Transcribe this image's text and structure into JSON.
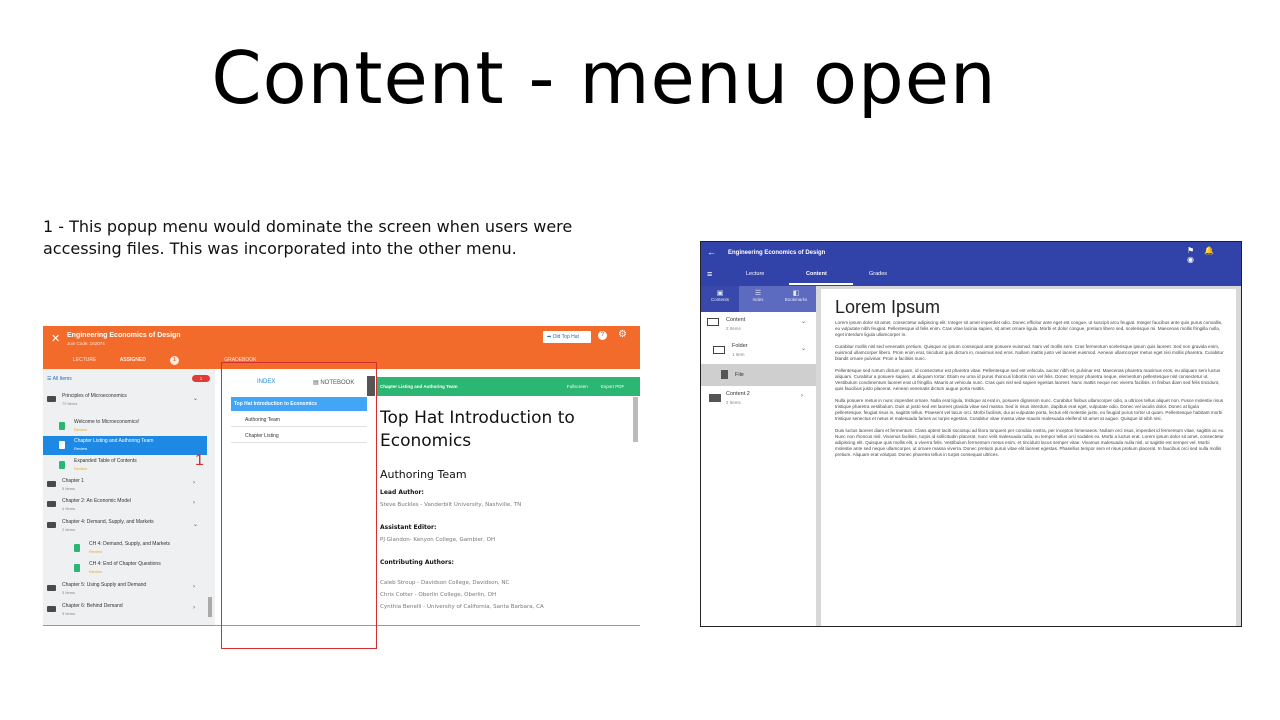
{
  "slide": {
    "title": "Content - menu open",
    "caption": "1 - This popup menu would dominate the screen when users were accessing files. This was incorporated into the other menu."
  },
  "left": {
    "course_title": "Engineering Economics of Design",
    "join_code": "Join Code: 162074",
    "tabs": [
      "LECTURE",
      "ASSIGNED",
      "GRADEBOOK"
    ],
    "assigned_badge": "1",
    "old_top_hat": "Old Top Hat",
    "filter_label": "All Items",
    "filter_badge": "1",
    "marker": "1",
    "sidebar": [
      {
        "title": "Principles of Microeconomics",
        "sub": "79 Items",
        "kind": "folder",
        "chev": "⌄"
      },
      {
        "title": "Welcome to Microeconomics!",
        "sub": "Review",
        "kind": "file",
        "chev": ""
      },
      {
        "title": "Chapter Listing and Authoring Team",
        "sub": "Review",
        "kind": "file",
        "chev": ""
      },
      {
        "title": "Expanded Table of Contents",
        "sub": "Review",
        "kind": "file",
        "chev": ""
      },
      {
        "title": "Chapter 1",
        "sub": "5 Items",
        "kind": "folder",
        "chev": "›"
      },
      {
        "title": "Chapter 2: An Economic Model",
        "sub": "4 Items",
        "kind": "folder",
        "chev": "›"
      },
      {
        "title": "Chapter 4: Demand, Supply, and Markets",
        "sub": "2 Items",
        "kind": "folder",
        "chev": "⌄"
      },
      {
        "title": "CH 4: Demand, Supply, and Markets",
        "sub": "Review",
        "kind": "file",
        "chev": ""
      },
      {
        "title": "CH 4: End of Chapter Questions",
        "sub": "Review",
        "kind": "file",
        "chev": ""
      },
      {
        "title": "Chapter 5: Using Supply and Demand",
        "sub": "3 Items",
        "kind": "folder",
        "chev": "›"
      },
      {
        "title": "Chapter 6: Behind Demand",
        "sub": "3 Items",
        "kind": "folder",
        "chev": "›"
      }
    ],
    "popup": {
      "tab_index": "INDEX",
      "tab_notebook": "NOTEBOOK",
      "rows": [
        "Top Hat Introduction to Economics",
        "Authoring Team",
        "Chapter Listing"
      ]
    },
    "content_bar": {
      "title": "Chapter Listing and Authoring Team",
      "fullscreen": "Fullscreen",
      "export": "Export PDF"
    },
    "doc": {
      "h1": "Top Hat Introduction to Economics",
      "h2": "Authoring Team",
      "lead_label": "Lead Author:",
      "lead": "Steve Buckles - Vanderbilt University, Nashville, TN",
      "assistant_label": "Assistant Editor:",
      "assistant": "PJ Glandon- Kenyon College, Gambier, OH",
      "contrib_label": "Contributing Authors:",
      "contributors": [
        "Caleb Stroup - Davidson College, Davidson, NC",
        "Chris Cotter - Oberlin College, Oberlin, OH",
        "Cynthia Benelli - University of California, Santa Barbara, CA"
      ]
    }
  },
  "right": {
    "title": "Engineering Economics of Design",
    "tabs": [
      "Lecture",
      "Content",
      "Grades"
    ],
    "subtabs": [
      "Contents",
      "Index",
      "Bookmarks"
    ],
    "nav": [
      {
        "title": "Content",
        "sub": "2 Items",
        "chev": "⌄"
      },
      {
        "title": "Folder",
        "sub": "1 Item",
        "chev": "⌄"
      },
      {
        "title": "File",
        "sub": "",
        "chev": ""
      },
      {
        "title": "Content 2",
        "sub": "2 Items",
        "chev": "›"
      }
    ],
    "page_title": "Lorem Ipsum",
    "paragraphs": [
      "Lorem ipsum dolor sit amet, consectetur adipiscing elit. Integer sit amet imperdiet odio. Donec efficitur ante eget est congue, ut suscipit arcu feugiat. Integer faucibus ante quis purus convallis, eu vulputate nibh feugiat. Pellentesque id felis enim. Cras vitae lacinia sapien, sit amet ornare ligula. Morbi et dolor congue, pretium libero sed, scelerisque mi. Maecenas mollis fringilla nulla, eget interdum ligula ullamcorper in.",
      "Curabitur mollis nisl sed venenatis pretium. Quisque ac ipsum consequat ante posuere euismod. Nam vel mollis sem. Cras fermentum scelerisque ipsum quis laoreet. Sed non gravida enim, euismod ullamcorper libero. Proin enim erat, tincidunt quis dictum in, maximus sed eros. Nullam mattis justo vel laoreet euismod. Aenean ullamcorper metus eget nisi mollis pharetra. Curabitur blandit ornare pulvinar. Proin a facilisis nunc.",
      "Pellentesque sed rutrum dictum quam, id consectetur est pharetra vitae. Pellentesque sed est vehicula, auctor nibh et, pulvinar est. Maecenas pharetra maximus eros, eu aliquam sem luctus aliquam. Curabitur a posuere sapien, ut aliquam tortor. Etiam eu urna id purus rhoncus lobortis non vel felis. Donec tempor pharetra neque, elementum pellentesque nisl consectetur ut. Vestibulum condimentum laoreet erat ut fringilla. Mauris at vehicula nunc. Cras quis nisl sed sapien egestas laoreet. Nunc mattis neque nec viverra facilisis. In finibus diam sed felis tincidunt, quis faucibus justo placerat. Aenean venenatis dictum augue porta mattis.",
      "Nulla posuere metus in nunc imperdiet ornare. Nulla erat ligula, tristique at erat in, posuere dignissim nunc. Curabitur finibus ullamcorper odio, a ultrices tellus aliquet non. Fusce molestie risus tristique pharetra vestibulum. Duis ut justo sed est laoreet gravida vitae sed massa. Sed in risus interdum, dapibus erat eget, vulputate odio. Donec vel iaculis dolor. Donec at ligula pellentesque, feugiat risus in, sagittis tellus. Praesent vel lacus orci. Morbi facilisis, dui at vulputate porta, lectus elit molestie justo, eu feugiat purus tortor ut quam. Pellentesque habitant morbi tristique senectus et netus et malesuada fames ac turpis egestas. Curabitur vitae massa vitae mauris malesuada eleifend sit amet at augue. Quisque id nibh nisi.",
      "Duis luctus laoreet diam et fermentum. Class aptent taciti sociosqu ad litora torquent per conubia nostra, per inceptos himenaeos. Nullam orci risus, imperdiet id fermentum vitae, sagittis ac ex. Nunc non rhoncus nisl. Vivamus facilisis, turpis id sollicitudin placerat, nunc velit malesuada nulla, eu tempor tellus orci sodales ex. Morbi a luctus erat. Lorem ipsum dolor sit amet, consectetur adipiscing elit. Quisque quis mollis elit, a viverra felis. Vestibulum fermentum metus enim, et tincidunt lacus semper vitae. Vivamus malesuada nulla nisl, ut sagittis est semper vel. Morbi molestie ante sed neque ullamcorper, ut ornare massa viverra. Donec pretium purus vitae elit laoreet egestas. Phasellus tempor sem et risus pretium placerat. In faucibus orci sed nulla mollis pretium. Aliquam erat volutpat. Donec pharetra tellus in turpis consequat ultrices."
    ]
  }
}
